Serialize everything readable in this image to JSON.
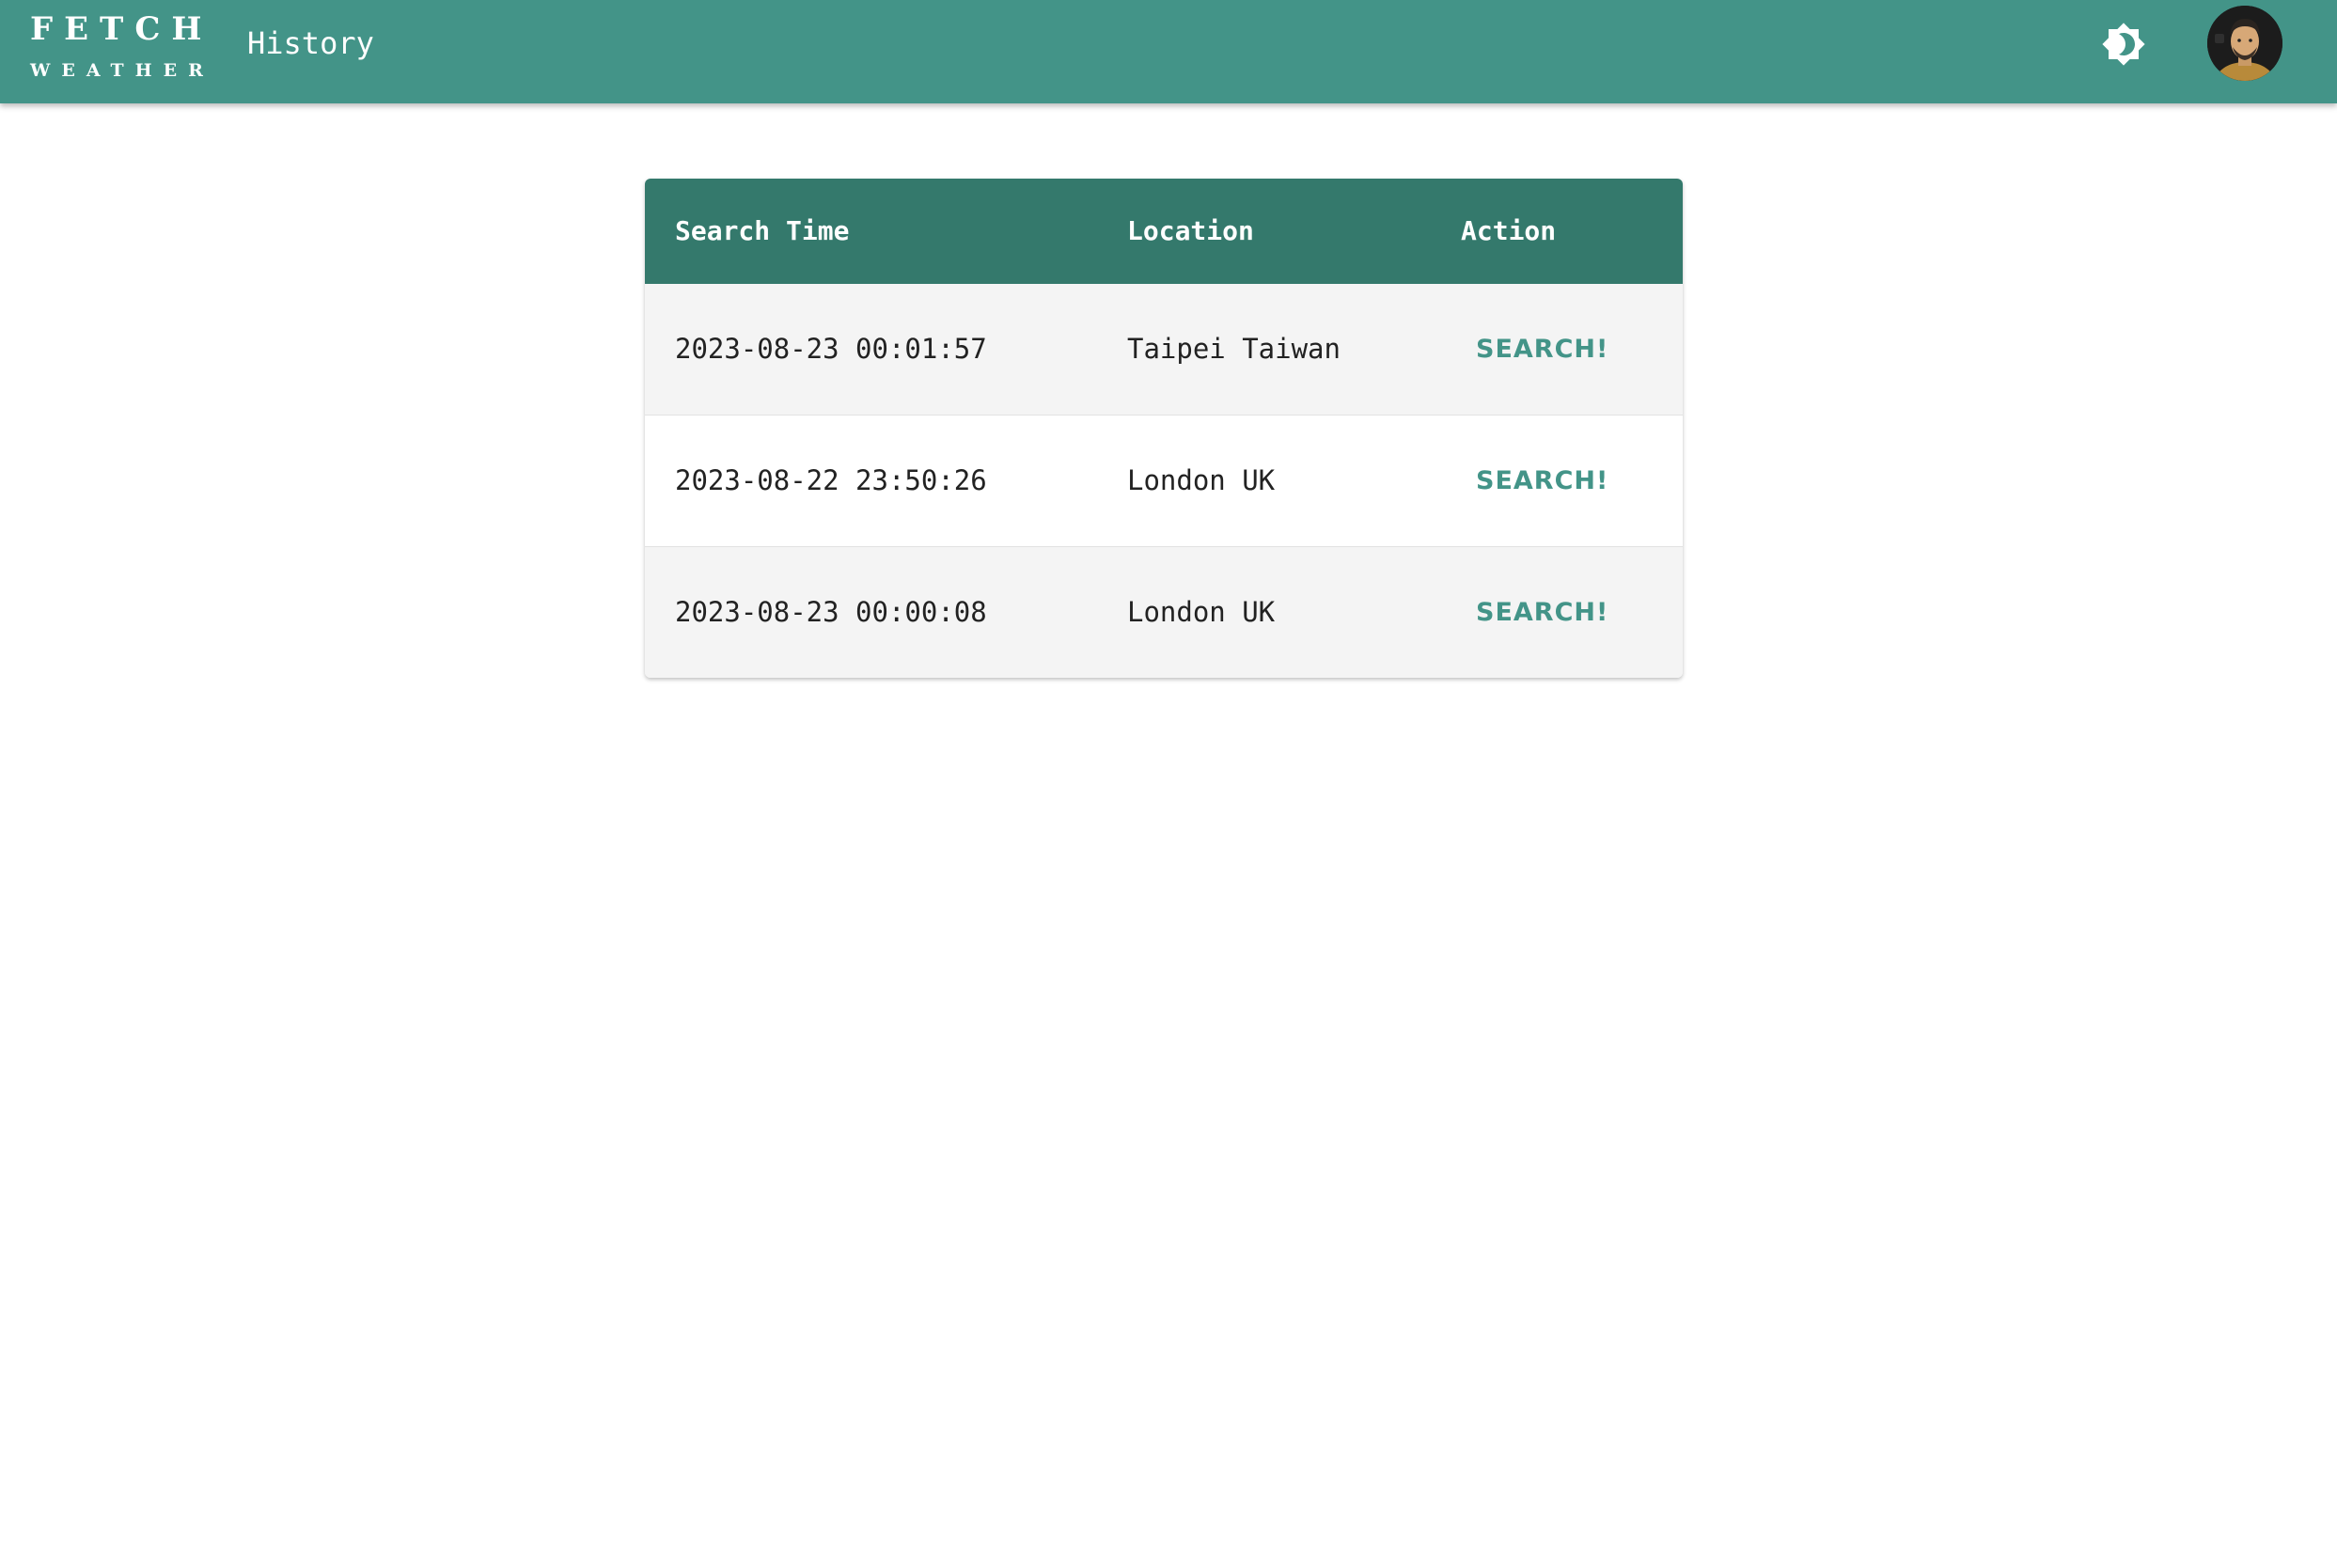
{
  "header": {
    "logo_line1": "FETCH",
    "logo_line2": "WEATHER",
    "page_title": "History",
    "theme_toggle_icon": "brightness-icon",
    "avatar_icon": "user-avatar",
    "bar_color": "#439488"
  },
  "table": {
    "columns": [
      "Search Time",
      "Location",
      "Action"
    ],
    "header_color": "#34796c",
    "rows": [
      {
        "time": "2023-08-23 00:01:57",
        "location": "Taipei Taiwan",
        "action": "SEARCH!"
      },
      {
        "time": "2023-08-22 23:50:26",
        "location": "London UK",
        "action": "SEARCH!"
      },
      {
        "time": "2023-08-23 00:00:08",
        "location": "London UK",
        "action": "SEARCH!"
      }
    ]
  }
}
